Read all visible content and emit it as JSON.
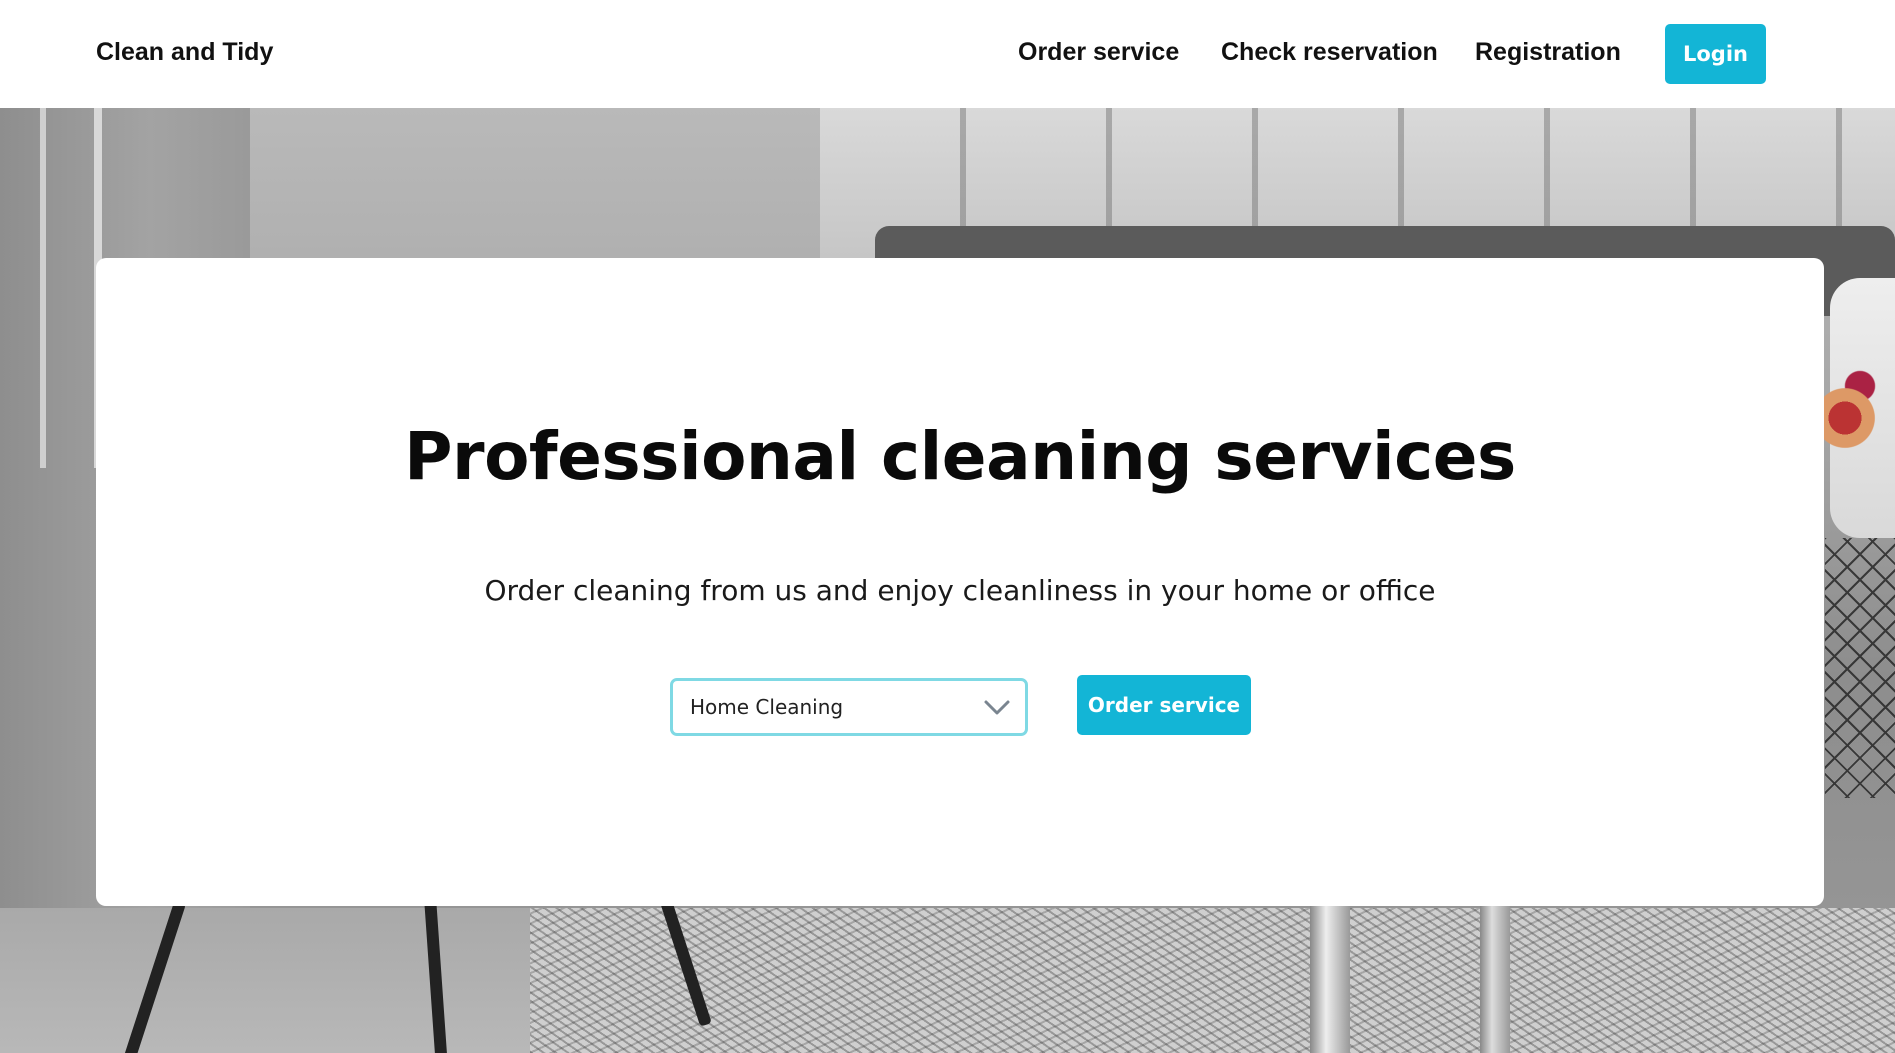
{
  "navbar": {
    "brand": "Clean and Tidy",
    "links": [
      {
        "label": "Order service"
      },
      {
        "label": "Check reservation"
      },
      {
        "label": "Registration"
      }
    ],
    "login_label": "Login"
  },
  "hero": {
    "title": "Professional cleaning services",
    "subtitle": "Order cleaning from us and enjoy cleanliness in your home or office",
    "service_select": {
      "selected": "Home Cleaning",
      "icon": "chevron-down-icon"
    },
    "order_label": "Order service"
  },
  "colors": {
    "accent": "#13b5d6",
    "select_border": "#7fd9e4",
    "text": "#111111"
  }
}
